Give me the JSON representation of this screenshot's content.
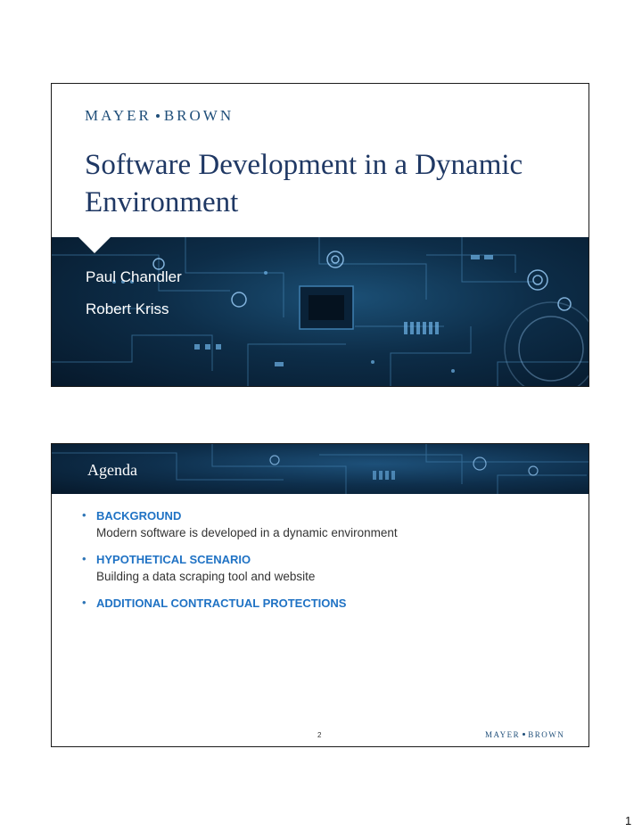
{
  "brand": {
    "name_left": "MAYER",
    "name_right": "BROWN",
    "color": "#1f4e79"
  },
  "slide1": {
    "title": "Software Development in a Dynamic Environment",
    "presenters": [
      "Paul Chandler",
      "Robert Kriss"
    ]
  },
  "slide2": {
    "heading": "Agenda",
    "items": [
      {
        "head": "BACKGROUND",
        "sub": "Modern software is developed in a dynamic environment"
      },
      {
        "head": "HYPOTHETICAL SCENARIO",
        "sub": "Building a data scraping tool and website"
      },
      {
        "head": "ADDITIONAL CONTRACTUAL PROTECTIONS",
        "sub": ""
      }
    ],
    "page_number": "2"
  },
  "document_page_number": "1",
  "colors": {
    "accent_blue": "#1f72c4",
    "title_navy": "#1f3864",
    "circuit_dark": "#06182a"
  }
}
